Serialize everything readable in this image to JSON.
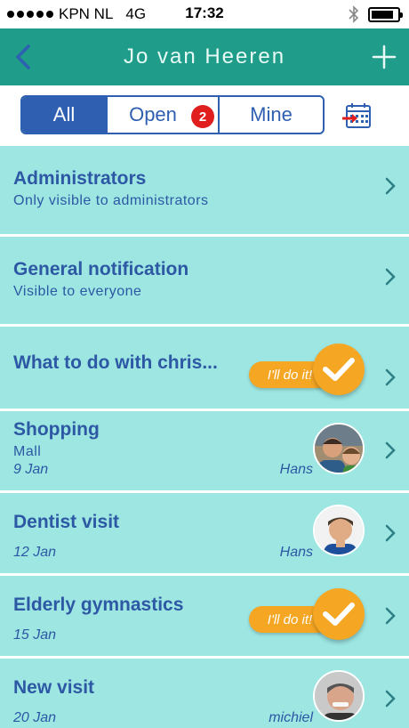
{
  "status_bar": {
    "carrier": "KPN NL",
    "network": "4G",
    "time": "17:32"
  },
  "header": {
    "title": "Jo van Heeren",
    "back_icon": "chevron-left-icon",
    "add_icon": "plus-icon"
  },
  "filter": {
    "tabs": [
      {
        "label": "All",
        "selected": true
      },
      {
        "label": "Open",
        "badge": "2"
      },
      {
        "label": "Mine"
      }
    ],
    "calendar_icon": "calendar-icon"
  },
  "colors": {
    "header": "#1f9d8a",
    "accent": "#2e5fb0",
    "row": "#9de6e2",
    "badge": "#e01e1e",
    "volunteer": "#f5a623"
  },
  "items": [
    {
      "title": "Administrators",
      "subtitle": "Only visible to administrators"
    },
    {
      "title": "General notification",
      "subtitle": "Visible to everyone"
    },
    {
      "title": "What to do with chris...",
      "action": "I'll do it!"
    },
    {
      "title": "Shopping",
      "subtitle": "Mall",
      "date": "9 Jan",
      "assignee": "Hans"
    },
    {
      "title": "Dentist visit",
      "date": "12 Jan",
      "assignee": "Hans"
    },
    {
      "title": "Elderly gymnastics",
      "date": "15 Jan",
      "action": "I'll do it!"
    },
    {
      "title": "New visit",
      "date": "20 Jan",
      "assignee": "michiel"
    }
  ]
}
